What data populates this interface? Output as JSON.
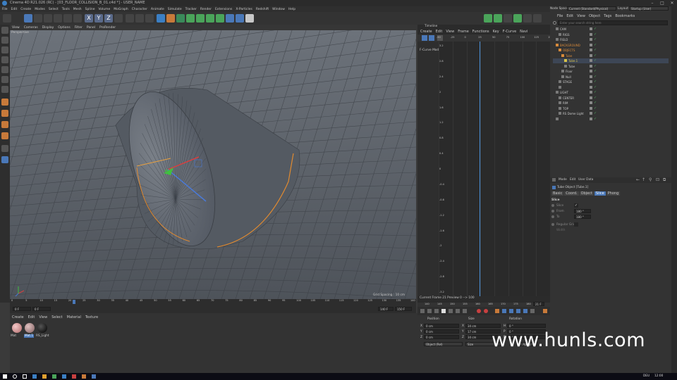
{
  "window": {
    "title": "Cinema 4D R21.026 (RC) - [03_FLOOR_COLLISION_B_01.c4d *] - USER_NAME",
    "controls": [
      "–",
      "□",
      "✕"
    ]
  },
  "menu": [
    "File",
    "Edit",
    "Create",
    "Modes",
    "Select",
    "Tools",
    "Mesh",
    "Spline",
    "Volume",
    "MoGraph",
    "Character",
    "Animate",
    "Simulate",
    "Tracker",
    "Render",
    "Extensions",
    "X-Particles",
    "Redshift",
    "Window",
    "Help"
  ],
  "viewport": {
    "menu": [
      "View",
      "Cameras",
      "Display",
      "Options",
      "Filter",
      "Panel",
      "ProRender"
    ],
    "label": "Perspective",
    "grid_spacing": "Grid Spacing : 10 cm"
  },
  "timebar": {
    "ticks": [
      "0",
      "5",
      "10",
      "15",
      "20",
      "25",
      "30",
      "35",
      "40",
      "45",
      "50",
      "55",
      "60",
      "65",
      "70",
      "75",
      "80",
      "85",
      "90",
      "95",
      "100",
      "105",
      "110",
      "115",
      "120",
      "125",
      "130",
      "135",
      "140"
    ],
    "start": "0 F",
    "start2": "0 F",
    "end": "140 F",
    "end2": "150 F",
    "current_frame_progress": 0.15
  },
  "material_manager": {
    "menu": [
      "Create",
      "Edit",
      "View",
      "Select",
      "Material",
      "Texture"
    ],
    "materials": [
      {
        "name": "Mat",
        "color": "#d9a0a0"
      },
      {
        "name": "Mat.1",
        "color": "#b08a8a"
      },
      {
        "name": "RS_Light",
        "color": "#111111"
      }
    ]
  },
  "timeline": {
    "title": "Timeline",
    "menu": [
      "Create",
      "Edit",
      "View",
      "Frame",
      "Functions",
      "Key",
      "F-Curve",
      "Navi"
    ],
    "label": "F-Curve Mode",
    "xticks": [
      "-50",
      "-25",
      "0",
      "25",
      "50",
      "75",
      "100",
      "125",
      "150"
    ],
    "yticks": [
      "3.2",
      "2.8",
      "2.4",
      "2",
      "1.6",
      "1.2",
      "0.8",
      "0.4",
      "0",
      "-0.4",
      "-0.8",
      "-1.2",
      "-1.6",
      "-2",
      "-2.4",
      "-2.8",
      "-3.2"
    ],
    "status": "Current Frame  21  Preview  0 --> 100",
    "bottom_ticks": [
      "140",
      "145",
      "150",
      "155",
      "160",
      "165",
      "170",
      "175",
      "180"
    ],
    "frame_field": "21 F"
  },
  "coordinates": {
    "headers": [
      "Position",
      "Size",
      "Rotation"
    ],
    "rows": [
      {
        "axis": "X",
        "pos": "0 cm",
        "size_axis": "X",
        "size": "34 cm",
        "rot_axis": "H",
        "rot": "0 °"
      },
      {
        "axis": "Y",
        "pos": "0 cm",
        "size_axis": "Y",
        "size": "17 cm",
        "rot_axis": "P",
        "rot": "0 °"
      },
      {
        "axis": "Z",
        "pos": "0 cm",
        "size_axis": "Z",
        "size": "34 cm",
        "rot_axis": "B",
        "rot": "0 °"
      }
    ],
    "mode_select": "Object (Rel)",
    "size_select": "Size",
    "apply": "Apply"
  },
  "node_space": {
    "label": "Node Space:",
    "value": "Current (Standard/Physical)",
    "layout_label": "Layout:",
    "layout_value": "Startup (User)"
  },
  "object_manager": {
    "menu": [
      "File",
      "Edit",
      "View",
      "Object",
      "Tags",
      "Bookmarks"
    ],
    "search_placeholder": "Enter your search string here",
    "objects": [
      {
        "name": "CAM",
        "indent": 1,
        "color": "#c8c8c8"
      },
      {
        "name": "RIGS",
        "indent": 2,
        "color": "#c8c8c8"
      },
      {
        "name": "FIELD",
        "indent": 1,
        "color": "#c8c8c8"
      },
      {
        "name": "BACKGROUND",
        "indent": 1,
        "color": "#d88a3a"
      },
      {
        "name": "OBJECTS",
        "indent": 2,
        "color": "#d88a3a"
      },
      {
        "name": "Tube",
        "indent": 3,
        "color": "#d88a3a"
      },
      {
        "name": "Tube.1",
        "indent": 4,
        "color": "#d8c34a"
      },
      {
        "name": "Tube",
        "indent": 4,
        "color": "#c8c8c8"
      },
      {
        "name": "Floor",
        "indent": 3,
        "color": "#c8c8c8"
      },
      {
        "name": "Null",
        "indent": 3,
        "color": "#c8c8c8"
      },
      {
        "name": "STAGE",
        "indent": 2,
        "color": "#c8c8c8"
      },
      {
        "name": "",
        "indent": 2,
        "color": "#c8c8c8"
      },
      {
        "name": "LIGHT",
        "indent": 1,
        "color": "#c8c8c8"
      },
      {
        "name": "CENTER",
        "indent": 2,
        "color": "#c8c8c8"
      },
      {
        "name": "RIM",
        "indent": 2,
        "color": "#c8c8c8"
      },
      {
        "name": "TOP",
        "indent": 2,
        "color": "#c8c8c8"
      },
      {
        "name": "RS Dome Light",
        "indent": 2,
        "color": "#c8c8c8"
      },
      {
        "name": "",
        "indent": 1,
        "color": "#c8c8c8"
      }
    ]
  },
  "attributes": {
    "menu": [
      "Mode",
      "Edit",
      "User Data"
    ],
    "object_title": "Tube Object [Tube.1]",
    "tabs": [
      "Basic",
      "Coord.",
      "Object",
      "Slice",
      "Phong"
    ],
    "active_tab": "Slice",
    "section": "Slice",
    "params": [
      {
        "label": "Slice",
        "value": "✓"
      },
      {
        "label": "From",
        "value": "180 °"
      },
      {
        "label": "To",
        "value": "180 °"
      },
      {
        "label": "Regular Grid",
        "value": ""
      },
      {
        "label": "Width",
        "value": ""
      }
    ]
  },
  "taskbar": {
    "tray": "DEU",
    "time": "12:00"
  },
  "watermark": "www.hunls.com",
  "colors": {
    "accent": "#4a90d9",
    "selection": "#d88a3a"
  }
}
